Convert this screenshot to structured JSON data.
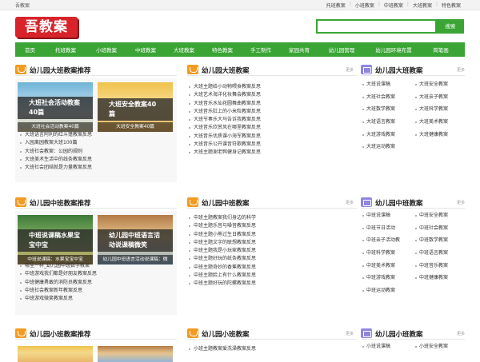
{
  "top": {
    "brand": "吾教案",
    "links": [
      "托班教案",
      "小班教案",
      "中班教案",
      "大班教案",
      "特色教案"
    ]
  },
  "header": {
    "logo_text": "吾教案",
    "search_placeholder": "",
    "search_button": "搜索"
  },
  "nav": [
    "首页",
    "托班教案",
    "小班教案",
    "中班教案",
    "大班教案",
    "特色教案",
    "手工制作",
    "家园共育",
    "幼儿园管理",
    "幼儿园环境布置",
    "简笔画"
  ],
  "sections": [
    {
      "left": {
        "title": "幼儿园大班教案推荐",
        "thumbs": [
          {
            "big": "大班社会活动教案40篇",
            "caption": "大班社会活动教案40篇"
          },
          {
            "big": "大班安全教案40篇",
            "caption": "大班安全教案40篇"
          }
        ],
        "items": [
          "大班语言阿利的红斗篷教案反思",
          "入园离园教案大班100篇",
          "大班社会教案：公园的规则",
          "大班美术生活中的线条教案反思",
          "大班社会团结就是力量教案反思"
        ]
      },
      "middle": {
        "title": "幼儿园大班教案",
        "more": "更多",
        "items": [
          "大班主题给小动物喂食教案反思",
          "大班艺术海洋化妆舞会教案反思",
          "大班音乐水仙花圆舞曲教案反思",
          "大班音乐肚上的小米粒教案反思",
          "大班节奏乐大马告诉我教案反思",
          "大班音乐欣赏风在哪里教案反思",
          "大班音乐优质课小海军教案反思",
          "大班音乐公开课音符歌教案反思",
          "大班主题谢老鸭健身记教案反思"
        ]
      },
      "right": {
        "title": "幼儿园大班教案",
        "more": "更多",
        "items": [
          "大班说课稿",
          "大班安全教案",
          "大班社会教案",
          "大班亲子教案",
          "大班数学教案",
          "大班科学教案",
          "大班语言教案",
          "大班美术教案",
          "大班游戏教案",
          "大班健康教案",
          "大班运动教案"
        ]
      }
    },
    {
      "left": {
        "title": "幼儿园中班教案推荐",
        "thumbs": [
          {
            "big": "中班说课稿水果宝宝中宝",
            "caption": "中班说课稿：水果宝宝中宝"
          },
          {
            "big": "幼儿园中班语言活动说课稿微笑",
            "caption": "幼儿园中班语言活动说课稿：微"
          }
        ],
        "items": [
          "哪里一样_幼儿园中班数学教案",
          "中班游戏我们都是好朋友教案反思",
          "中班健康勇敢的消防员教案反思",
          "中班社会教案新年教案反思",
          "中班游戏微笑教案反思"
        ]
      },
      "middle": {
        "title": "幼儿园中班教案",
        "more": "更多",
        "items": [
          "中班主题教案我们身边的科学",
          "中班主题乐音与噪音教案反思",
          "中班主题小熊过生日教案反思",
          "中班主题文字的联想教案反思",
          "中班主题我是小玩家教案反思",
          "中班主题好玩的纸条教案反思",
          "中班主题奇妙的香蕉教案反思",
          "中班主题脸上有什么教案反思",
          "中班主题好玩的陀螺教案反思"
        ]
      },
      "right": {
        "title": "幼儿园中班教案",
        "more": "更多",
        "items": [
          "中班说课稿",
          "中班安全教案",
          "中班节日活动",
          "中班社会教案",
          "中班亲子活动教",
          "中班数学教案",
          "中班科学教案",
          "中班语言教案",
          "中班美术教案",
          "中班音乐教案",
          "中班游戏教案",
          "中班健康教案",
          "中班运动教案"
        ]
      }
    },
    {
      "left": {
        "title": "幼儿园小班教案推荐",
        "thumbs": [],
        "items": []
      },
      "middle": {
        "title": "幼儿园小班教案",
        "more": "更多",
        "items": [
          "小班主题教案爱洗澡教案反思"
        ]
      },
      "right": {
        "title": "幼儿园小班教案",
        "more": "更多",
        "items": [
          "小班说课稿",
          "小班安全教案"
        ]
      }
    }
  ]
}
